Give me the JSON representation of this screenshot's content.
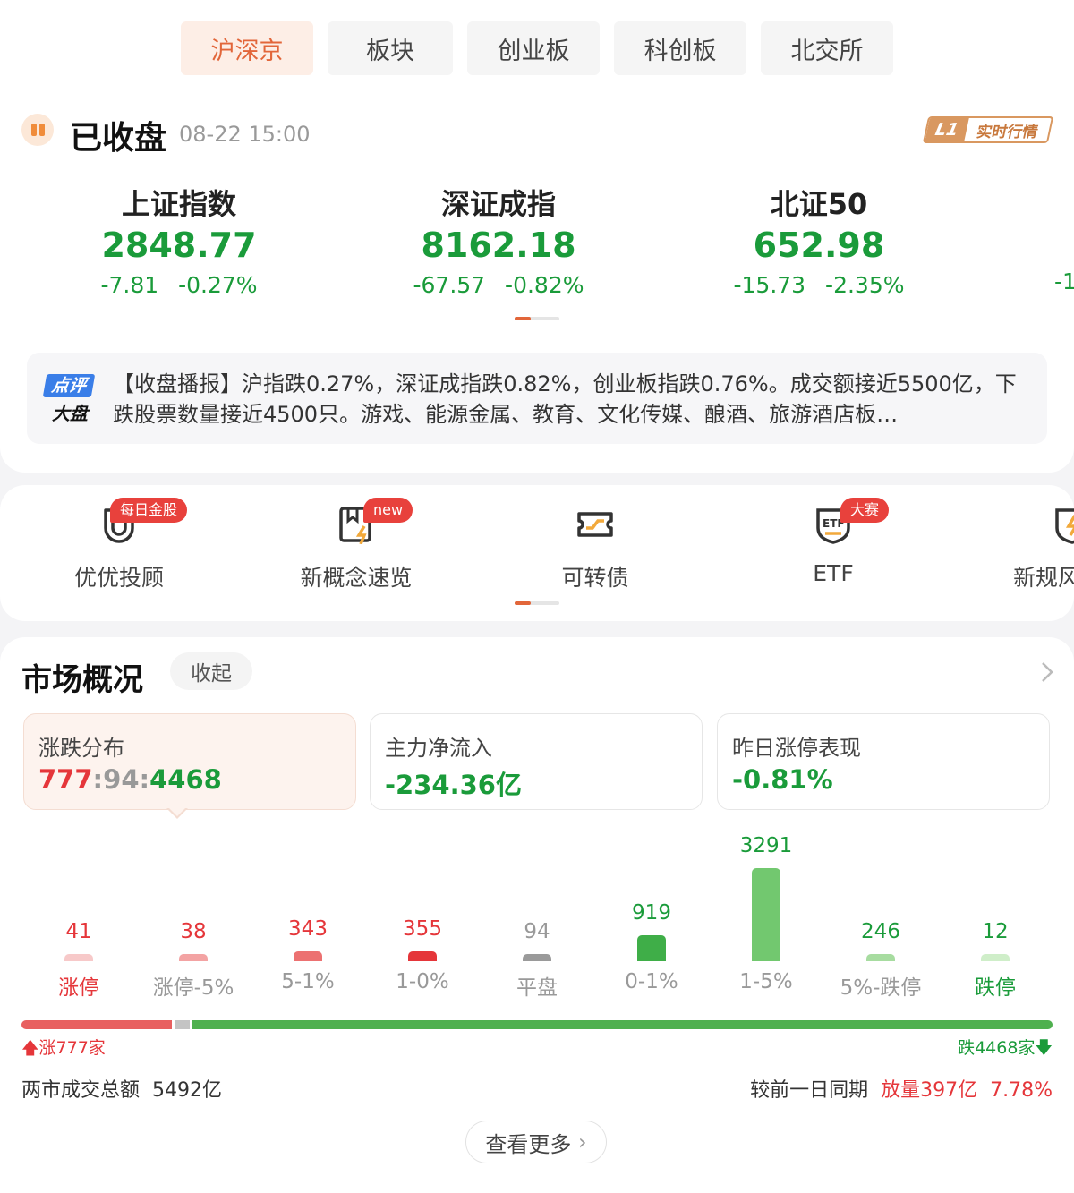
{
  "tabs": [
    {
      "label": "沪深京",
      "active": true
    },
    {
      "label": "板块",
      "active": false
    },
    {
      "label": "创业板",
      "active": false
    },
    {
      "label": "科创板",
      "active": false
    },
    {
      "label": "北交所",
      "active": false
    }
  ],
  "status": {
    "title": "已收盘",
    "time": "08-22 15:00",
    "badge_l1": "L1",
    "badge_text": "实时行情"
  },
  "indices": [
    {
      "name": "上证指数",
      "value": "2848.77",
      "change": "-7.81",
      "percent": "-0.27%"
    },
    {
      "name": "深证成指",
      "value": "8162.18",
      "change": "-67.57",
      "percent": "-0.82%"
    },
    {
      "name": "北证50",
      "value": "652.98",
      "change": "-15.73",
      "percent": "-2.35%"
    }
  ],
  "index_partial": "-1",
  "news": {
    "logo_top": "点评",
    "logo_bottom": "大盘",
    "text": "【收盘播报】沪指跌0.27%，深证成指跌0.82%，创业板指跌0.76%。成交额接近5500亿，下跌股票数量接近4500只。游戏、能源金属、教育、文化传媒、酿酒、旅游酒店板…"
  },
  "tools": [
    {
      "label": "优优投顾",
      "icon": "magnet-icon",
      "tag": "每日金股"
    },
    {
      "label": "新概念速览",
      "icon": "concept-book-icon",
      "tag": "new"
    },
    {
      "label": "可转债",
      "icon": "bond-ticket-icon",
      "tag": ""
    },
    {
      "label": "ETF",
      "icon": "etf-shield-icon",
      "tag": "大赛"
    },
    {
      "label": "新规风",
      "icon": "shield-icon",
      "tag": ""
    }
  ],
  "market": {
    "title": "市场概况",
    "collapse": "收起",
    "stats": [
      {
        "label": "涨跌分布",
        "up": "777",
        "flat": "94",
        "down": "4468",
        "sep": ":"
      },
      {
        "label": "主力净流入",
        "value": "-234.36亿"
      },
      {
        "label": "昨日涨停表现",
        "value": "-0.81%"
      }
    ],
    "up_label": "涨777家",
    "down_label": "跌4468家",
    "turnover_label": "两市成交总额",
    "turnover_value": "5492亿",
    "compare_label": "较前一日同期",
    "compare_change": "放量397亿",
    "compare_pct": "7.78%",
    "more": "查看更多"
  },
  "chart_data": {
    "type": "bar",
    "categories": [
      "涨停",
      "涨停-5%",
      "5-1%",
      "1-0%",
      "平盘",
      "0-1%",
      "1-5%",
      "5%-跌停",
      "跌停"
    ],
    "values": [
      41,
      38,
      343,
      355,
      94,
      919,
      3291,
      246,
      12
    ],
    "colors": [
      "#f7c9c9",
      "#f3a3a3",
      "#ec7171",
      "#e5363a",
      "#9a9a9a",
      "#3fae48",
      "#72c86f",
      "#a7dca0",
      "#cfeec9"
    ],
    "label_colors": [
      "#e5363a",
      "#999999",
      "#999999",
      "#999999",
      "#999999",
      "#999999",
      "#999999",
      "#999999",
      "#1a9b3a"
    ],
    "value_colors": [
      "#e5363a",
      "#e5363a",
      "#e5363a",
      "#e5363a",
      "#999999",
      "#1a9b3a",
      "#1a9b3a",
      "#1a9b3a",
      "#1a9b3a"
    ]
  },
  "colors": {
    "up": "#e5363a",
    "down": "#1a9b3a",
    "accent": "#e2663a"
  }
}
